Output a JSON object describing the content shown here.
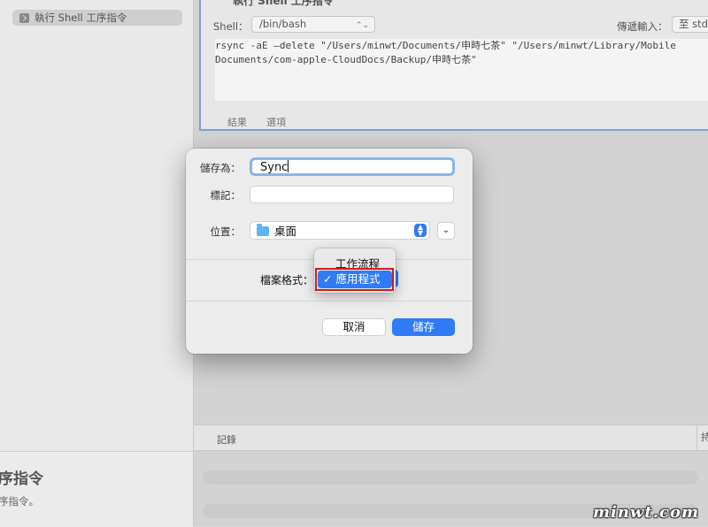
{
  "sidebar": {
    "action_item": "執行 Shell 工序指令",
    "description_title": "序指令",
    "description_body": "序指令。"
  },
  "action_card": {
    "title": "執行 Shell 工序指令",
    "shell_label": "Shell：",
    "shell_value": "/bin/bash",
    "pass_input_label": "傳遞輸入：",
    "pass_input_value": "至 stdin",
    "script_lines": [
      "rsync -aE —delete \"/Users/minwt/Documents/申時七茶\" \"/Users/minwt/Library/Mobile",
      "Documents/com-apple-CloudDocs/Backup/申時七茶\""
    ],
    "tab_results": "結果",
    "tab_options": "選項"
  },
  "log": {
    "label": "記錄",
    "col2": "持"
  },
  "dialog": {
    "save_as_label": "儲存為：",
    "save_as_value": "Sync",
    "tags_label": "標記：",
    "location_label": "位置：",
    "location_value": "桌面",
    "format_label": "檔案格式：",
    "format_options": [
      "工作流程",
      "應用程式"
    ],
    "selected_format": "應用程式",
    "check_mark": "✓",
    "cancel_label": "取消",
    "save_label": "儲存"
  },
  "watermark": "minwt.com",
  "colors": {
    "accent": "#2f7bf6",
    "highlight": "#d21a1a"
  }
}
